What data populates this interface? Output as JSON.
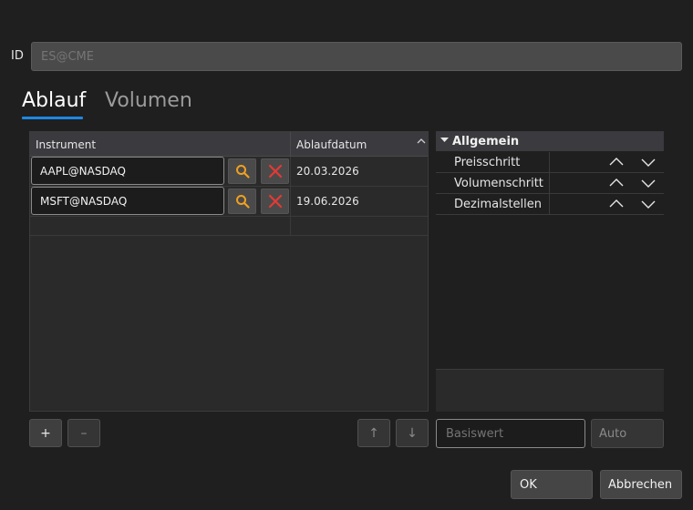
{
  "id_field": {
    "label": "ID",
    "placeholder": "ES@CME"
  },
  "tabs": [
    {
      "label": "Ablauf",
      "active": true
    },
    {
      "label": "Volumen",
      "active": false
    }
  ],
  "table": {
    "columns": [
      "Instrument",
      "Ablaufdatum"
    ],
    "rows": [
      {
        "instrument": "AAPL@NASDAQ",
        "expiry": "20.03.2026"
      },
      {
        "instrument": "MSFT@NASDAQ",
        "expiry": "19.06.2026"
      }
    ]
  },
  "table_buttons": {
    "add": "+",
    "remove": "–",
    "up": "↑",
    "down": "↓"
  },
  "properties": {
    "group": "Allgemein",
    "items": [
      {
        "label": "Preisschritt"
      },
      {
        "label": "Volumenschritt"
      },
      {
        "label": "Dezimalstellen"
      }
    ]
  },
  "basiswert": {
    "placeholder": "Basiswert"
  },
  "auto_label": "Auto",
  "dialog": {
    "ok": "OK",
    "cancel": "Abbrechen"
  },
  "colors": {
    "accent": "#1e88e5",
    "search_icon": "#f0a020",
    "delete_icon": "#e53935"
  }
}
